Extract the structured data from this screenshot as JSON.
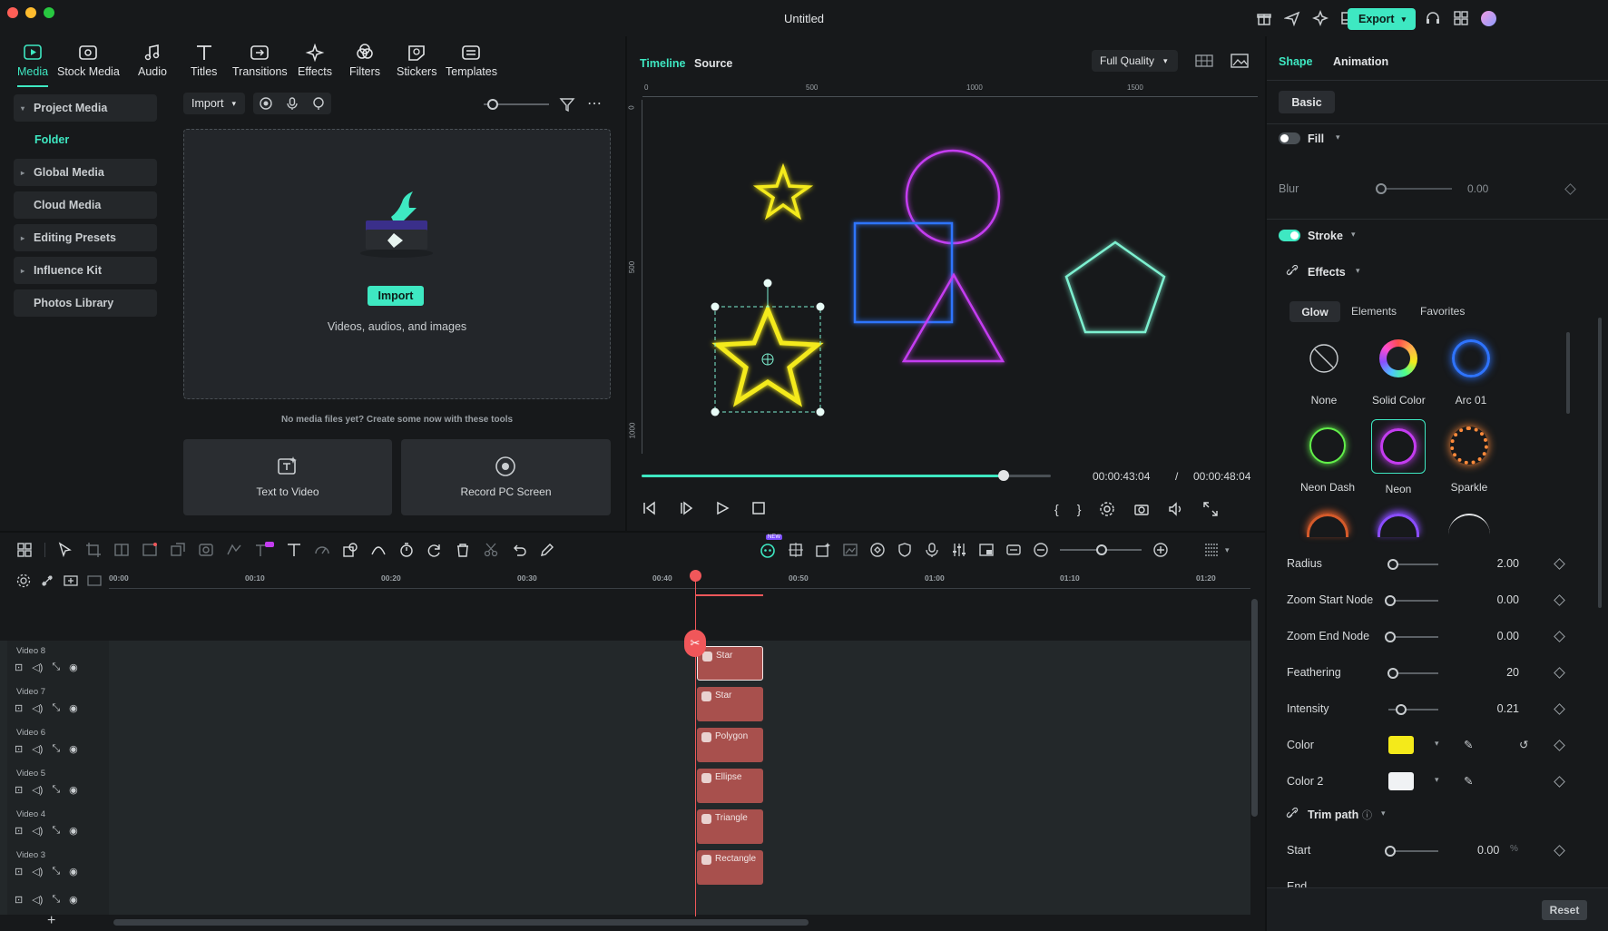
{
  "window": {
    "title": "Untitled",
    "export_label": "Export"
  },
  "media_tabs": [
    {
      "label": "Media"
    },
    {
      "label": "Stock Media"
    },
    {
      "label": "Audio"
    },
    {
      "label": "Titles"
    },
    {
      "label": "Transitions"
    },
    {
      "label": "Effects"
    },
    {
      "label": "Filters"
    },
    {
      "label": "Stickers"
    },
    {
      "label": "Templates"
    }
  ],
  "sidebar": {
    "items": [
      {
        "label": "Project Media"
      },
      {
        "label": "Folder"
      },
      {
        "label": "Global Media"
      },
      {
        "label": "Cloud Media"
      },
      {
        "label": "Editing Presets"
      },
      {
        "label": "Influence Kit"
      },
      {
        "label": "Photos Library"
      }
    ]
  },
  "media": {
    "import_dropdown": "Import",
    "import_button": "Import",
    "drop_hint": "Videos, audios, and images",
    "no_media": "No media files yet? Create some now with these tools",
    "text_to_video": "Text to Video",
    "record_screen": "Record PC Screen"
  },
  "player": {
    "tab_timeline": "Timeline",
    "tab_source": "Source",
    "quality": "Full Quality",
    "ruler": [
      "0",
      "500",
      "1000",
      "1500"
    ],
    "vruler": [
      "0",
      "500",
      "1000"
    ],
    "current_time": "00:00:43:04",
    "separator": "/",
    "total_time": "00:00:48:04",
    "progress": 0.885
  },
  "timeline": {
    "ruler": [
      "00:00",
      "00:10",
      "00:20",
      "00:30",
      "00:40",
      "00:50",
      "01:00",
      "01:10",
      "01:20"
    ],
    "ai_badge": "NEW",
    "tracks": [
      {
        "label": "Video 8",
        "clip": "Star"
      },
      {
        "label": "Video 7",
        "clip": "Star"
      },
      {
        "label": "Video 6",
        "clip": "Polygon"
      },
      {
        "label": "Video 5",
        "clip": "Ellipse"
      },
      {
        "label": "Video 4",
        "clip": "Triangle"
      },
      {
        "label": "Video 3",
        "clip": "Rectangle"
      }
    ]
  },
  "props": {
    "tab_shape": "Shape",
    "tab_animation": "Animation",
    "basic": "Basic",
    "fill": "Fill",
    "blur_label": "Blur",
    "blur_value": "0.00",
    "stroke": "Stroke",
    "effects": "Effects",
    "effect_tabs": [
      "Glow",
      "Elements",
      "Favorites"
    ],
    "effect_items": [
      {
        "label": "None"
      },
      {
        "label": "Solid Color"
      },
      {
        "label": "Arc 01"
      },
      {
        "label": "Neon Dash"
      },
      {
        "label": "Neon"
      },
      {
        "label": "Sparkle"
      }
    ],
    "params": [
      {
        "label": "Radius",
        "value": "2.00",
        "level": 0.05
      },
      {
        "label": "Zoom Start Node",
        "value": "0.00",
        "level": 0.0
      },
      {
        "label": "Zoom End Node",
        "value": "0.00",
        "level": 0.0
      },
      {
        "label": "Feathering",
        "value": "20",
        "level": 0.05
      },
      {
        "label": "Intensity",
        "value": "0.21",
        "level": 0.21
      }
    ],
    "color_label": "Color",
    "color": "#f4ea1a",
    "color2_label": "Color 2",
    "color2": "#f0f2f4",
    "trim_path": "Trim path",
    "start_label": "Start",
    "start_value": "0.00",
    "start_unit": "%",
    "end_label": "End",
    "reset": "Reset"
  },
  "colors": {
    "accent": "#3ee8c2",
    "clip": "#a8504d",
    "playhead": "#f0575a",
    "neon_yellow": "#f4ea1a",
    "neon_magenta": "#c43cf0",
    "neon_blue": "#2e74ff",
    "neon_teal": "#7df0d0"
  }
}
